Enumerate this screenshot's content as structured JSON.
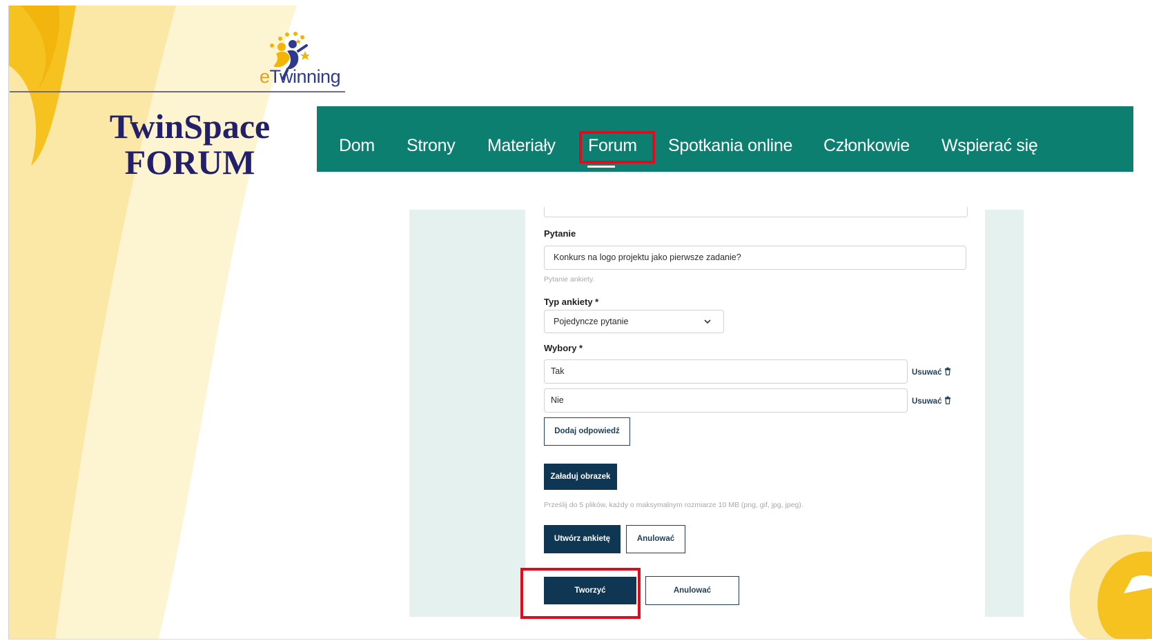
{
  "header": {
    "logo_text_prefix": "e",
    "logo_text_rest": "Twinning",
    "title_line1": "TwinSpace",
    "title_line2": "FORUM"
  },
  "nav": {
    "items": [
      "Dom",
      "Strony",
      "Materiały",
      "Forum",
      "Spotkania online",
      "Członkowie",
      "Wspierać się"
    ],
    "active": "Forum",
    "color": "#0d7f70"
  },
  "form": {
    "question_label": "Pytanie",
    "question_value": "Konkurs na logo projektu jako pierwsze zadanie?",
    "question_hint": "Pytanie ankiety.",
    "type_label": "Typ ankiety *",
    "type_value": "Pojedyncze pytanie",
    "choices_label": "Wybory *",
    "choices": [
      {
        "value": "Tak",
        "remove_label": "Usuwać"
      },
      {
        "value": "Nie",
        "remove_label": "Usuwać"
      }
    ],
    "add_answer_label": "Dodaj odpowiedź",
    "upload_label": "Załaduj obrazek",
    "upload_hint": "Prześlij do 5 plików, każdy o maksymalnym rozmiarze 10 MB (png, gif, jpg, jpeg).",
    "create_poll_label": "Utwórz ankietę",
    "cancel_poll_label": "Anulować",
    "create_label": "Tworzyć",
    "cancel_label": "Anulować"
  },
  "colors": {
    "accent_dark": "#0f3653",
    "highlight": "#e10b1d",
    "panel_bg": "#e5f1ef"
  }
}
